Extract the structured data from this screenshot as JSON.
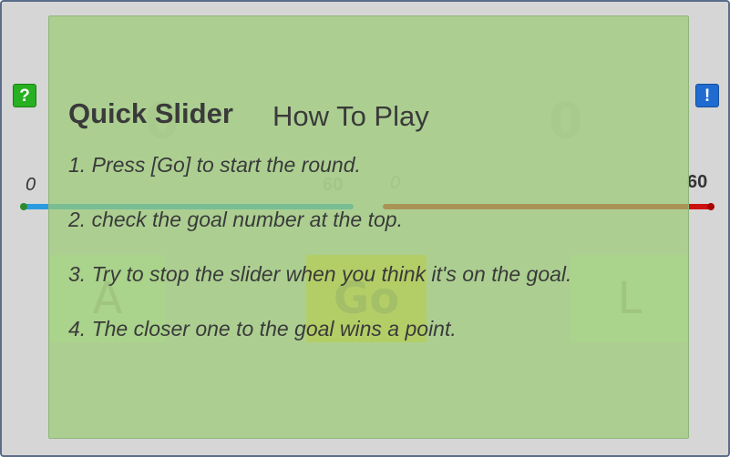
{
  "game": {
    "score_left": "0",
    "score_right": "0",
    "help_label": "?",
    "info_label": "!",
    "min_left": "0",
    "max_right": "60",
    "left_current": "60",
    "right_current": "0",
    "buttons": {
      "a": "A",
      "go": "Go",
      "l": "L"
    },
    "colors": {
      "left_track": "#2b9be0",
      "right_track": "#cc1111",
      "go_button": "#f1d44c",
      "overlay": "#9acc73"
    }
  },
  "help": {
    "title": "Quick Slider",
    "subtitle": "How To Play",
    "instructions": [
      "1. Press [Go] to start the round.",
      "2. check the goal number at the top.",
      "3. Try to stop the slider when you think it's on the goal.",
      "4. The closer one to the goal wins a point."
    ]
  }
}
